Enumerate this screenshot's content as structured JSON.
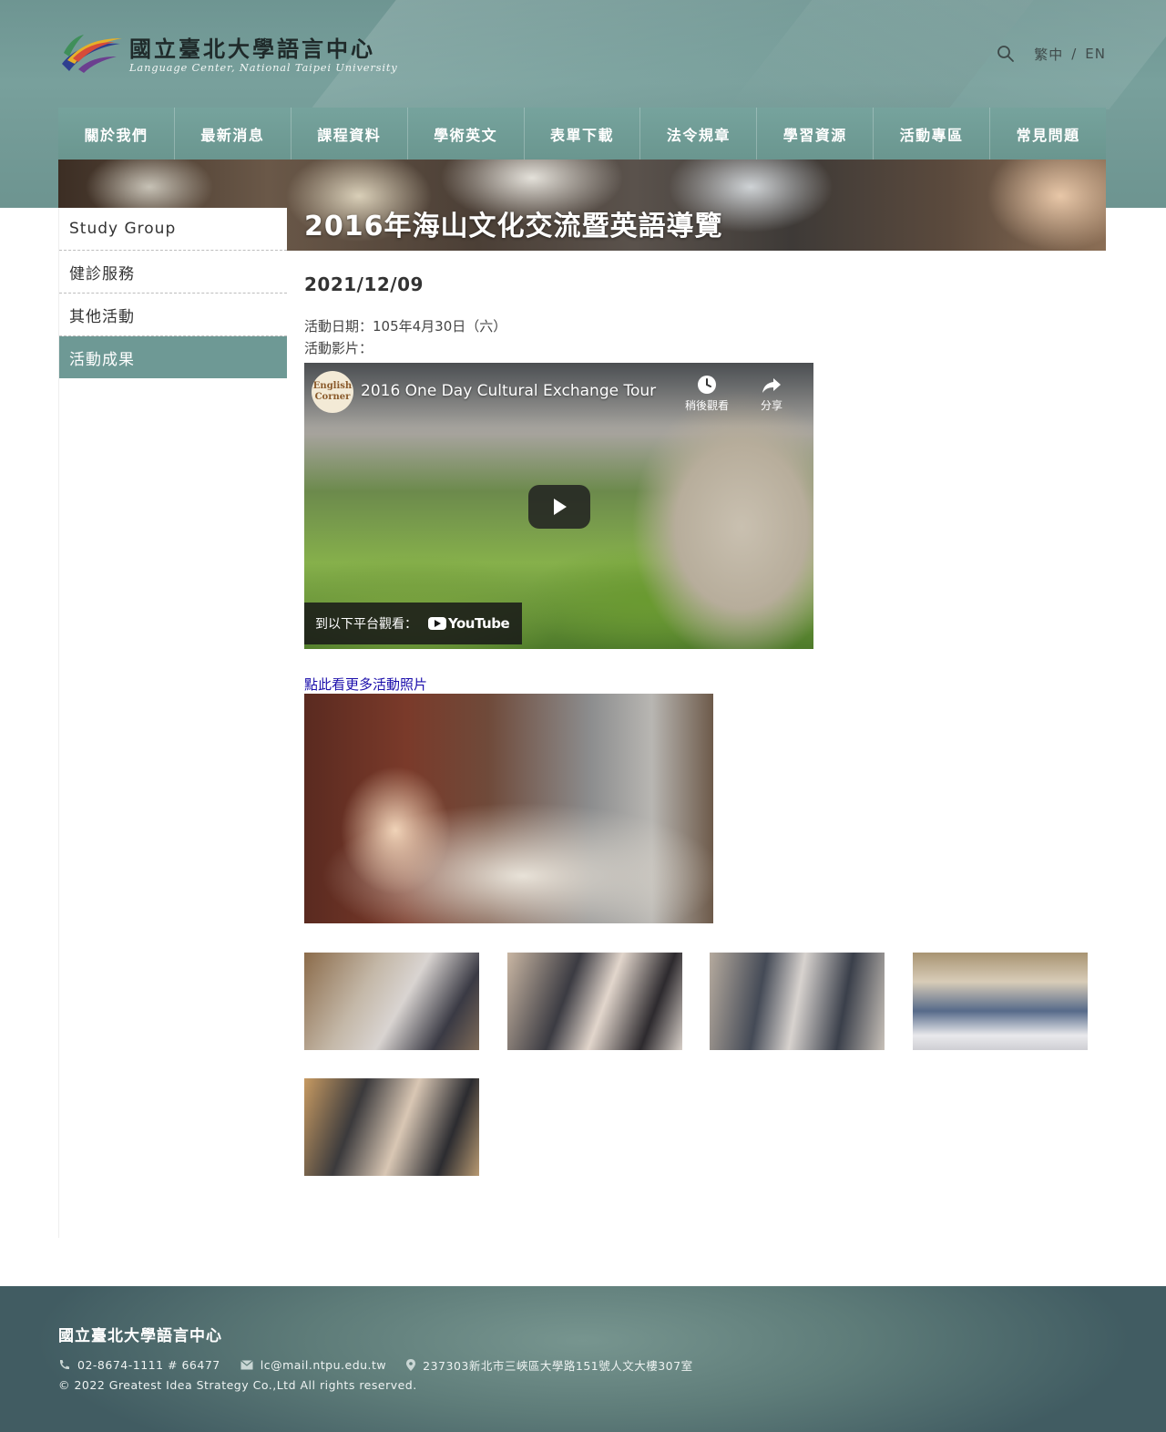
{
  "header": {
    "logo_zh": "國立臺北大學語言中心",
    "logo_en": "Language Center, National Taipei University",
    "lang_zh": "繁中",
    "lang_sep": "/",
    "lang_en": "EN"
  },
  "nav": {
    "items": [
      {
        "label": "關於我們"
      },
      {
        "label": "最新消息"
      },
      {
        "label": "課程資料"
      },
      {
        "label": "學術英文"
      },
      {
        "label": "表單下載"
      },
      {
        "label": "法令規章"
      },
      {
        "label": "學習資源"
      },
      {
        "label": "活動專區"
      },
      {
        "label": "常見問題"
      }
    ]
  },
  "banner": {
    "title": "2016年海山文化交流暨英語導覽"
  },
  "sidebar": {
    "items": [
      {
        "label": "Study Group",
        "active": false
      },
      {
        "label": "健診服務",
        "active": false
      },
      {
        "label": "其他活動",
        "active": false
      },
      {
        "label": "活動成果",
        "active": true
      }
    ]
  },
  "article": {
    "date": "2021/12/09",
    "activity_date": "活動日期：105年4月30日（六）",
    "activity_video": "活動影片：",
    "more_photos_link": "點此看更多活動照片"
  },
  "video": {
    "channel_line1": "English",
    "channel_line2": "Corner",
    "title": "2016 One Day Cultural Exchange Tour",
    "watch_later": "稍後觀看",
    "share": "分享",
    "watch_on": "到以下平台觀看：",
    "youtube": "YouTube"
  },
  "footer": {
    "title": "國立臺北大學語言中心",
    "phone": "02-8674-1111 # 66477",
    "email": "lc@mail.ntpu.edu.tw",
    "address": "237303新北市三峽區大學路151號人文大樓307室",
    "copyright": "© 2022 Greatest Idea Strategy Co.,Ltd All rights reserved."
  },
  "colors": {
    "header_teal": "#78a09c",
    "nav_teal": "#6e9b95",
    "sidebar_active": "#6e9995",
    "link_blue": "#1a0dab",
    "footer_dark": "#415c62"
  }
}
